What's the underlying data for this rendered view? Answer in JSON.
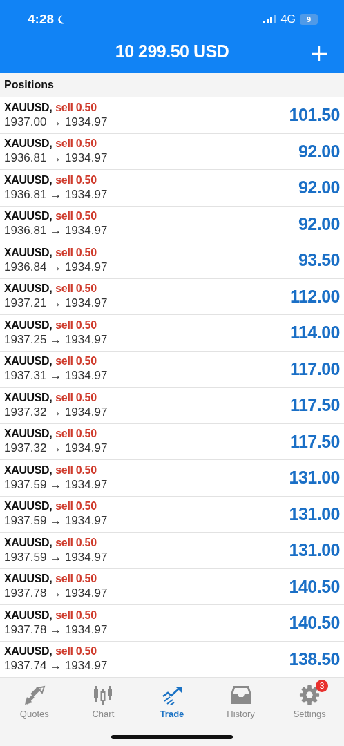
{
  "status_bar": {
    "time": "4:28",
    "network": "4G",
    "battery": "9"
  },
  "header": {
    "balance": "10 299.50 USD"
  },
  "section_title": "Positions",
  "positions": [
    {
      "symbol": "XAUUSD,",
      "order": "sell 0.50",
      "prices": "1937.00 → 1934.97",
      "profit": "101.50"
    },
    {
      "symbol": "XAUUSD,",
      "order": "sell 0.50",
      "prices": "1936.81 → 1934.97",
      "profit": "92.00"
    },
    {
      "symbol": "XAUUSD,",
      "order": "sell 0.50",
      "prices": "1936.81 → 1934.97",
      "profit": "92.00"
    },
    {
      "symbol": "XAUUSD,",
      "order": "sell 0.50",
      "prices": "1936.81 → 1934.97",
      "profit": "92.00"
    },
    {
      "symbol": "XAUUSD,",
      "order": "sell 0.50",
      "prices": "1936.84 → 1934.97",
      "profit": "93.50"
    },
    {
      "symbol": "XAUUSD,",
      "order": "sell 0.50",
      "prices": "1937.21 → 1934.97",
      "profit": "112.00"
    },
    {
      "symbol": "XAUUSD,",
      "order": "sell 0.50",
      "prices": "1937.25 → 1934.97",
      "profit": "114.00"
    },
    {
      "symbol": "XAUUSD,",
      "order": "sell 0.50",
      "prices": "1937.31 → 1934.97",
      "profit": "117.00"
    },
    {
      "symbol": "XAUUSD,",
      "order": "sell 0.50",
      "prices": "1937.32 → 1934.97",
      "profit": "117.50"
    },
    {
      "symbol": "XAUUSD,",
      "order": "sell 0.50",
      "prices": "1937.32 → 1934.97",
      "profit": "117.50"
    },
    {
      "symbol": "XAUUSD,",
      "order": "sell 0.50",
      "prices": "1937.59 → 1934.97",
      "profit": "131.00"
    },
    {
      "symbol": "XAUUSD,",
      "order": "sell 0.50",
      "prices": "1937.59 → 1934.97",
      "profit": "131.00"
    },
    {
      "symbol": "XAUUSD,",
      "order": "sell 0.50",
      "prices": "1937.59 → 1934.97",
      "profit": "131.00"
    },
    {
      "symbol": "XAUUSD,",
      "order": "sell 0.50",
      "prices": "1937.78 → 1934.97",
      "profit": "140.50"
    },
    {
      "symbol": "XAUUSD,",
      "order": "sell 0.50",
      "prices": "1937.78 → 1934.97",
      "profit": "140.50"
    },
    {
      "symbol": "XAUUSD,",
      "order": "sell 0.50",
      "prices": "1937.74 → 1934.97",
      "profit": "138.50"
    }
  ],
  "tab_bar": [
    {
      "kind": "quotes",
      "label": "Quotes",
      "selected": false
    },
    {
      "kind": "chart",
      "label": "Chart",
      "selected": false
    },
    {
      "kind": "trade",
      "label": "Trade",
      "selected": true
    },
    {
      "kind": "history",
      "label": "History",
      "selected": false
    },
    {
      "kind": "settings",
      "label": "Settings",
      "selected": false,
      "badge": "3"
    }
  ]
}
